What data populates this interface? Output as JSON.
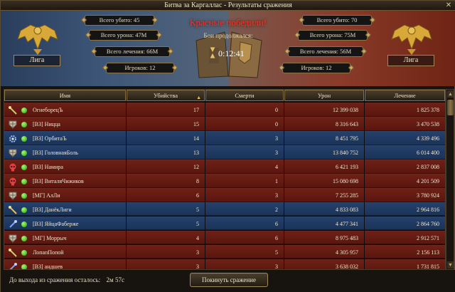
{
  "window": {
    "title": "Битва за Каргаллас - Результаты сражения",
    "close_label": "✕"
  },
  "header": {
    "victory_text": "Красные победили!",
    "battle_status": "Бои продолжался:",
    "timer": "0:12:41",
    "left": {
      "team": "Лига",
      "kills": "Всего убито: 45",
      "damage": "Всего урона: 47M",
      "healing": "Всего лечения: 66M",
      "players": "Игроков: 12",
      "color": "#3d5678"
    },
    "right": {
      "team": "Лига",
      "kills": "Всего убито: 70",
      "damage": "Всего урона: 75M",
      "healing": "Всего лечения: 56M",
      "players": "Игроков: 12",
      "color": "#8a3a28"
    }
  },
  "table": {
    "columns": [
      "Имя",
      "Убийства",
      "Смерти",
      "Урон",
      "Лечение"
    ],
    "sorted_column": "Убийства",
    "rows": [
      {
        "team": "red",
        "icon": "staff-icon",
        "name": "ОгнеборецЪ",
        "kills": "17",
        "deaths": "0",
        "damage": "12 399 038",
        "heal": "1 825 378"
      },
      {
        "team": "red",
        "icon": "shield-icon",
        "name": "[ВЗ] Ницца",
        "kills": "15",
        "deaths": "0",
        "damage": "8 316 643",
        "heal": "3 470 538"
      },
      {
        "team": "blue",
        "icon": "gear-icon",
        "name": "[ВЗ] ОрбитаЪ",
        "kills": "14",
        "deaths": "3",
        "damage": "8 451 795",
        "heal": "4 339 496"
      },
      {
        "team": "blue",
        "icon": "shield-icon",
        "name": "[ВЗ] ГоловнаяБоль",
        "kills": "13",
        "deaths": "3",
        "damage": "13 840 752",
        "heal": "6 014 400"
      },
      {
        "team": "red",
        "icon": "skull-icon",
        "name": "[ВЗ] Намира",
        "kills": "12",
        "deaths": "4",
        "damage": "6 421 193",
        "heal": "2 837 008"
      },
      {
        "team": "red",
        "icon": "skull-icon",
        "name": "[ВЗ] ВиталяЧижиков",
        "kills": "8",
        "deaths": "1",
        "damage": "15 080 698",
        "heal": "4 201 509"
      },
      {
        "team": "red",
        "icon": "shield-icon",
        "name": "[МГ] АлЛи",
        "kills": "6",
        "deaths": "3",
        "damage": "7 255 285",
        "heal": "3 780 924"
      },
      {
        "team": "blue",
        "icon": "staff-icon",
        "name": "[ВЗ] ДанёкЛиги",
        "kills": "5",
        "deaths": "2",
        "damage": "4 833 083",
        "heal": "2 964 816"
      },
      {
        "team": "blue",
        "icon": "wand-icon",
        "name": "[ВЗ] ЯйцаФаберже",
        "kills": "5",
        "deaths": "6",
        "damage": "4 477 341",
        "heal": "2 864 760"
      },
      {
        "team": "red",
        "icon": "shield-icon",
        "name": "[МГ] Моррыч",
        "kills": "4",
        "deaths": "6",
        "damage": "8 975 483",
        "heal": "2 912 571"
      },
      {
        "team": "red",
        "icon": "staff-icon",
        "name": "ЛопапПопой",
        "kills": "3",
        "deaths": "5",
        "damage": "4 305 957",
        "heal": "2 156 113"
      },
      {
        "team": "red",
        "icon": "wand-icon",
        "name": "[ВЗ] андшев",
        "kills": "3",
        "deaths": "3",
        "damage": "3 638 032",
        "heal": "1 731 815"
      }
    ]
  },
  "footer": {
    "exit_label": "До выхода из сражения осталось:",
    "exit_time": "2м 57с",
    "leave_button": "Покинуть сражение"
  }
}
